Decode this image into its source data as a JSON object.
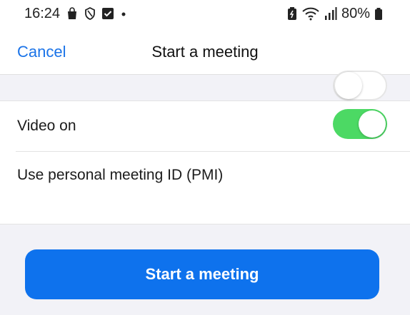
{
  "status_bar": {
    "time": "16:24",
    "battery_percent": "80%",
    "left_icons": [
      "shopping-bag-icon",
      "shield-icon",
      "checkbox-icon",
      "dot-icon"
    ],
    "right_icons": [
      "battery-saver-icon",
      "wifi-icon",
      "signal-icon",
      "battery-icon"
    ]
  },
  "header": {
    "cancel_label": "Cancel",
    "title": "Start a meeting"
  },
  "settings": {
    "video_on": {
      "label": "Video on",
      "enabled": true
    },
    "use_pmi": {
      "label": "Use personal meeting ID (PMI)",
      "enabled": false
    }
  },
  "start_button_label": "Start a meeting",
  "colors": {
    "accent": "#0e72ed",
    "link": "#1a73e8",
    "toggle_on": "#4cd964",
    "background": "#f2f2f7"
  }
}
